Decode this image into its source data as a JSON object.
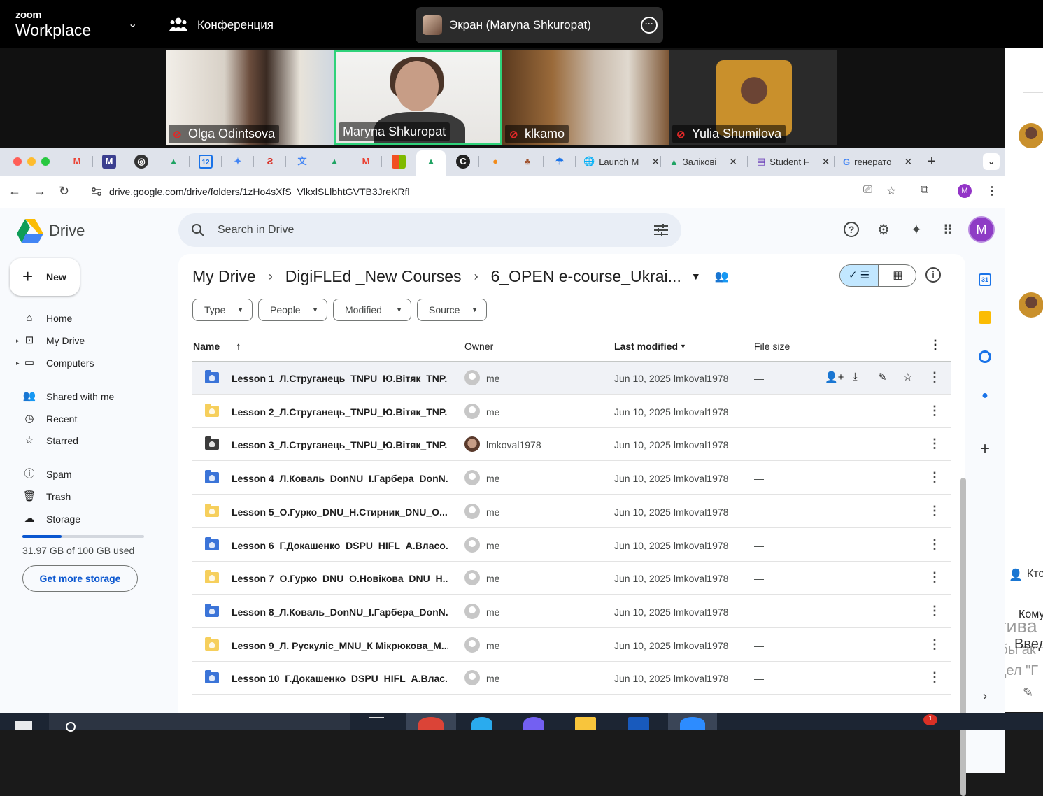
{
  "zoom": {
    "logo_small": "zoom",
    "logo_big": "Workplace",
    "conference_label": "Конференция",
    "screen_share_label": "Экран (Maryna Shkuropat)",
    "participants": [
      "Olga Odintsova",
      "Maryna Shkuropat",
      "klkamo",
      "Yulia Shumilova"
    ],
    "side_texts": {
      "who": "Кто",
      "to": "Кому",
      "activate_title": "Актива",
      "activate_line1": "Чтобы ак",
      "activate_enter": "Введ",
      "activate_line2": "раздел \"Г"
    }
  },
  "browser": {
    "tabs": [
      {
        "label": "Launch M"
      },
      {
        "label": "Залікові"
      },
      {
        "label": "Student F"
      },
      {
        "label": "генерато"
      }
    ],
    "url": "drive.google.com/drive/folders/1zHo4sXfS_VlkxlSLlbhtGVTB3JreKRfl",
    "profile_initial": "M"
  },
  "drive": {
    "app_name": "Drive",
    "search_placeholder": "Search in Drive",
    "avatar_initial": "M",
    "new_label": "New",
    "nav": [
      {
        "label": "Home",
        "icon": "home-icon"
      },
      {
        "label": "My Drive",
        "icon": "my-drive-icon"
      },
      {
        "label": "Computers",
        "icon": "computers-icon"
      },
      {
        "label": "Shared with me",
        "icon": "shared-icon"
      },
      {
        "label": "Recent",
        "icon": "clock-icon"
      },
      {
        "label": "Starred",
        "icon": "star-icon"
      },
      {
        "label": "Spam",
        "icon": "spam-icon"
      },
      {
        "label": "Trash",
        "icon": "trash-icon"
      },
      {
        "label": "Storage",
        "icon": "cloud-icon"
      }
    ],
    "storage": {
      "text": "31.97 GB of 100 GB used",
      "used_fraction": 0.3197,
      "button": "Get more storage"
    },
    "breadcrumb": [
      "My Drive",
      "DigiFLEd _New Courses",
      "6_OPEN e-course_Ukrai..."
    ],
    "filters": [
      "Type",
      "People",
      "Modified",
      "Source"
    ],
    "columns": {
      "name": "Name",
      "owner": "Owner",
      "modified": "Last modified",
      "size": "File size"
    },
    "rows": [
      {
        "name": "Lesson 1_Л.Струганець_TNPU_Ю.Вітяк_TNP...",
        "owner": "me",
        "modified": "Jun 10, 2025 lmkoval1978",
        "size": "—",
        "color": "#3b74d8",
        "photo": false
      },
      {
        "name": "Lesson 2_Л.Струганець_TNPU_Ю.Вітяк_TNP...",
        "owner": "me",
        "modified": "Jun 10, 2025 lmkoval1978",
        "size": "—",
        "color": "#f6cf5c",
        "photo": false
      },
      {
        "name": "Lesson 3_Л.Струганець_TNPU_Ю.Вітяк_TNP...",
        "owner": "lmkoval1978",
        "modified": "Jun 10, 2025 lmkoval1978",
        "size": "—",
        "color": "#3c3c3c",
        "photo": true
      },
      {
        "name": "Lesson 4_Л.Коваль_DonNU_І.Гарбера_DonN...",
        "owner": "me",
        "modified": "Jun 10, 2025 lmkoval1978",
        "size": "—",
        "color": "#3b74d8",
        "photo": false
      },
      {
        "name": "Lesson 5_О.Гурко_DNU_Н.Стирник_DNU_O....",
        "owner": "me",
        "modified": "Jun 10, 2025 lmkoval1978",
        "size": "—",
        "color": "#f6cf5c",
        "photo": false
      },
      {
        "name": "Lesson 6_Г.Докашенко_DSPU_HIFL_A.Власо...",
        "owner": "me",
        "modified": "Jun 10, 2025 lmkoval1978",
        "size": "—",
        "color": "#3b74d8",
        "photo": false
      },
      {
        "name": "Lesson 7_О.Гурко_DNU_О.Новікова_DNU_H....",
        "owner": "me",
        "modified": "Jun 10, 2025 lmkoval1978",
        "size": "—",
        "color": "#f6cf5c",
        "photo": false
      },
      {
        "name": "Lesson 8_Л.Коваль_DonNU_І.Гарбера_DonN...",
        "owner": "me",
        "modified": "Jun 10, 2025 lmkoval1978",
        "size": "—",
        "color": "#3b74d8",
        "photo": false
      },
      {
        "name": "Lesson 9_Л. Рускуліс_MNU_К Мікрюкова_M...",
        "owner": "me",
        "modified": "Jun 10, 2025 lmkoval1978",
        "size": "—",
        "color": "#f6cf5c",
        "photo": false
      },
      {
        "name": "Lesson 10_Г.Докашенко_DSPU_HIFL_A.Влас...",
        "owner": "me",
        "modified": "Jun 10, 2025 lmkoval1978",
        "size": "—",
        "color": "#3b74d8",
        "photo": false
      }
    ]
  }
}
